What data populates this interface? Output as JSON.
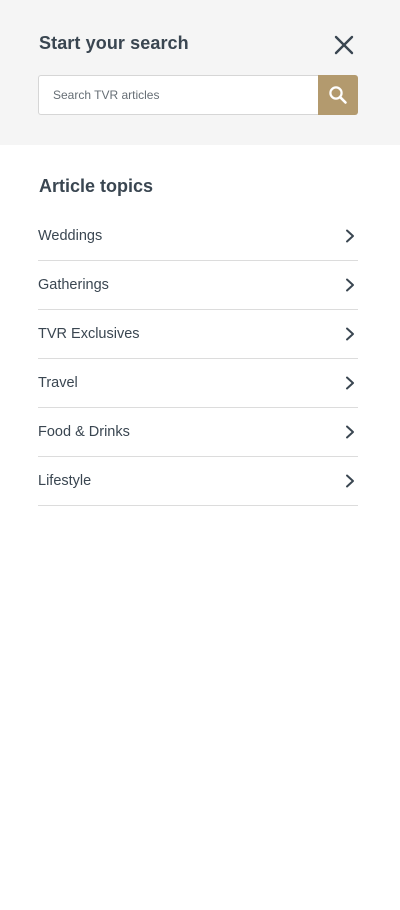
{
  "search": {
    "title": "Start your search",
    "placeholder": "Search TVR articles",
    "value": "",
    "close_icon": "close-icon",
    "submit_icon": "search-icon",
    "accent_color": "#b39a6e"
  },
  "topics": {
    "title": "Article topics",
    "items": [
      {
        "label": "Weddings",
        "icon": "chevron-right-icon"
      },
      {
        "label": "Gatherings",
        "icon": "chevron-right-icon"
      },
      {
        "label": "TVR Exclusives",
        "icon": "chevron-right-icon"
      },
      {
        "label": "Travel",
        "icon": "chevron-right-icon"
      },
      {
        "label": "Food & Drinks",
        "icon": "chevron-right-icon"
      },
      {
        "label": "Lifestyle",
        "icon": "chevron-right-icon"
      }
    ]
  }
}
